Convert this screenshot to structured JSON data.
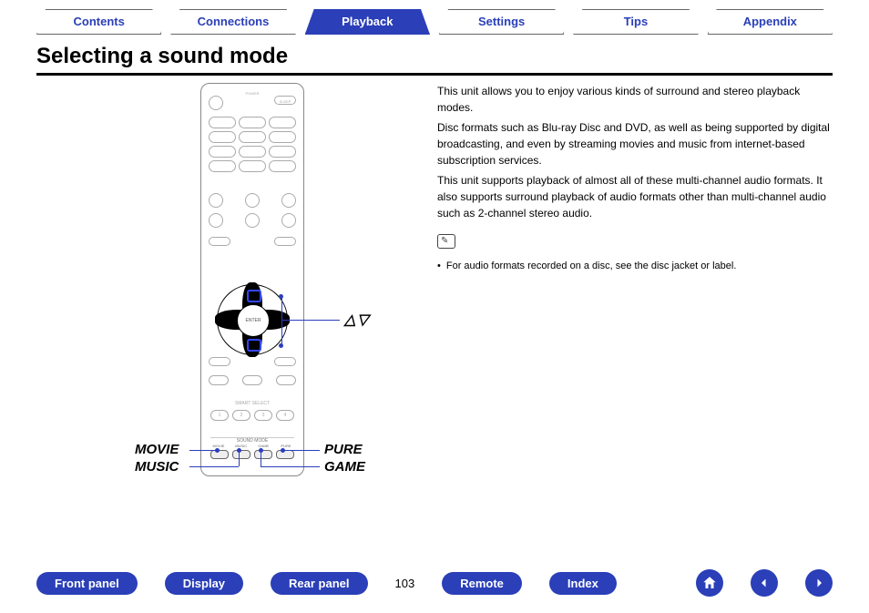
{
  "tabs": {
    "contents": "Contents",
    "connections": "Connections",
    "playback": "Playback",
    "settings": "Settings",
    "tips": "Tips",
    "appendix": "Appendix",
    "active": "playback"
  },
  "title": "Selecting a sound mode",
  "body": {
    "p1": "This unit allows you to enjoy various kinds of surround and stereo playback modes.",
    "p2": "Disc formats such as Blu-ray Disc and DVD, as well as being supported by digital broadcasting, and even by streaming movies and music from internet-based subscription services.",
    "p3": "This unit supports playback of almost all of these multi-channel audio formats. It also supports surround playback of audio formats other than multi-channel audio such as 2-channel stereo audio.",
    "note": "For audio formats recorded on a disc, see the disc jacket or label."
  },
  "callouts": {
    "movie": "MOVIE",
    "music": "MUSIC",
    "pure": "PURE",
    "game": "GAME",
    "arrows": "△▽"
  },
  "remote": {
    "power": "POWER",
    "sleep": "SLEEP",
    "enter": "ENTER",
    "smart": "SMART SELECT",
    "soundmode": "SOUND MODE",
    "sm": {
      "movie": "MOVIE",
      "music": "MUSIC",
      "game": "GAME",
      "pure": "PURE"
    },
    "smartnums": [
      "1",
      "2",
      "3",
      "4"
    ]
  },
  "bottom": {
    "front": "Front panel",
    "display": "Display",
    "rear": "Rear panel",
    "remote": "Remote",
    "index": "Index",
    "page": "103"
  }
}
